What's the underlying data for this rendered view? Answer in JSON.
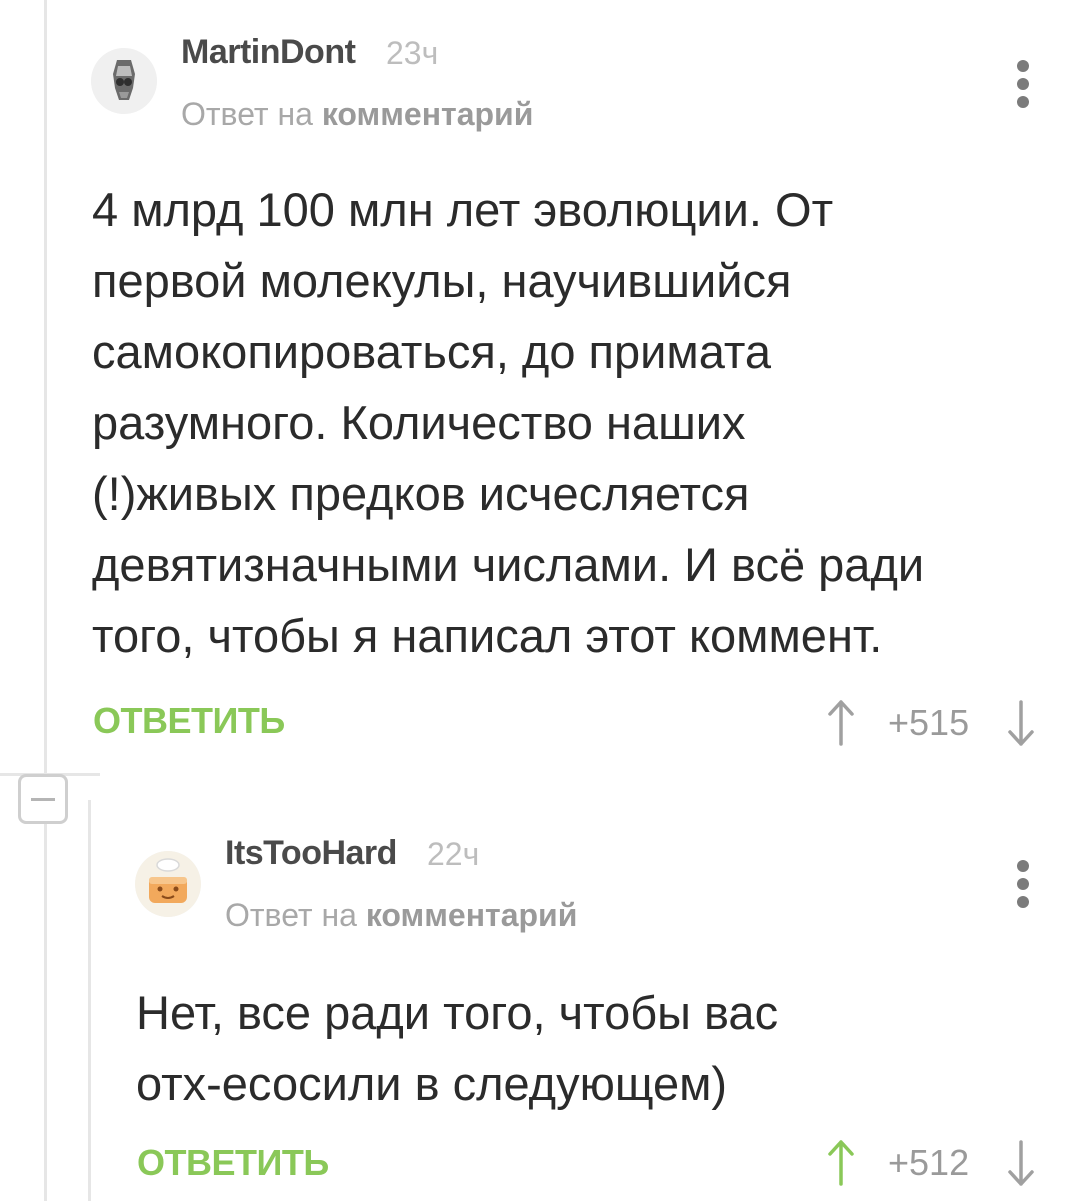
{
  "comments": [
    {
      "author": "MartinDont",
      "time": "23ч",
      "reply_prefix": "Ответ на",
      "reply_target": "комментарий",
      "text_lines": [
        "4 млрд 100 млн лет эволюции. От",
        "первой молекулы, научившийся",
        "самокопироваться, до примата",
        "разумного. Количество наших",
        "(!)живых предков исчесляется",
        "девятизначными числами. И всё ради",
        "того, чтобы я написал этот коммент."
      ],
      "reply_label": "ОТВЕТИТЬ",
      "rating": "+515",
      "upvoted": false
    },
    {
      "author": "ItsTooHard",
      "time": "22ч",
      "reply_prefix": "Ответ на",
      "reply_target": "комментарий",
      "text_lines": [
        "Нет, все ради того, чтобы вас",
        "отх-есосили в следующем)"
      ],
      "reply_label": "ОТВЕТИТЬ",
      "rating": "+512",
      "upvoted": true
    }
  ],
  "colors": {
    "accent_green": "#8ac858",
    "upvote_active": "#8ac858",
    "vote_inactive": "#a0a0a0"
  },
  "icons": {
    "avatar_1": "skull-avatar-icon",
    "avatar_2": "cake-avatar-icon",
    "menu": "more-vertical-icon",
    "up": "arrow-up-icon",
    "down": "arrow-down-icon",
    "collapse": "minus-collapse-icon"
  }
}
